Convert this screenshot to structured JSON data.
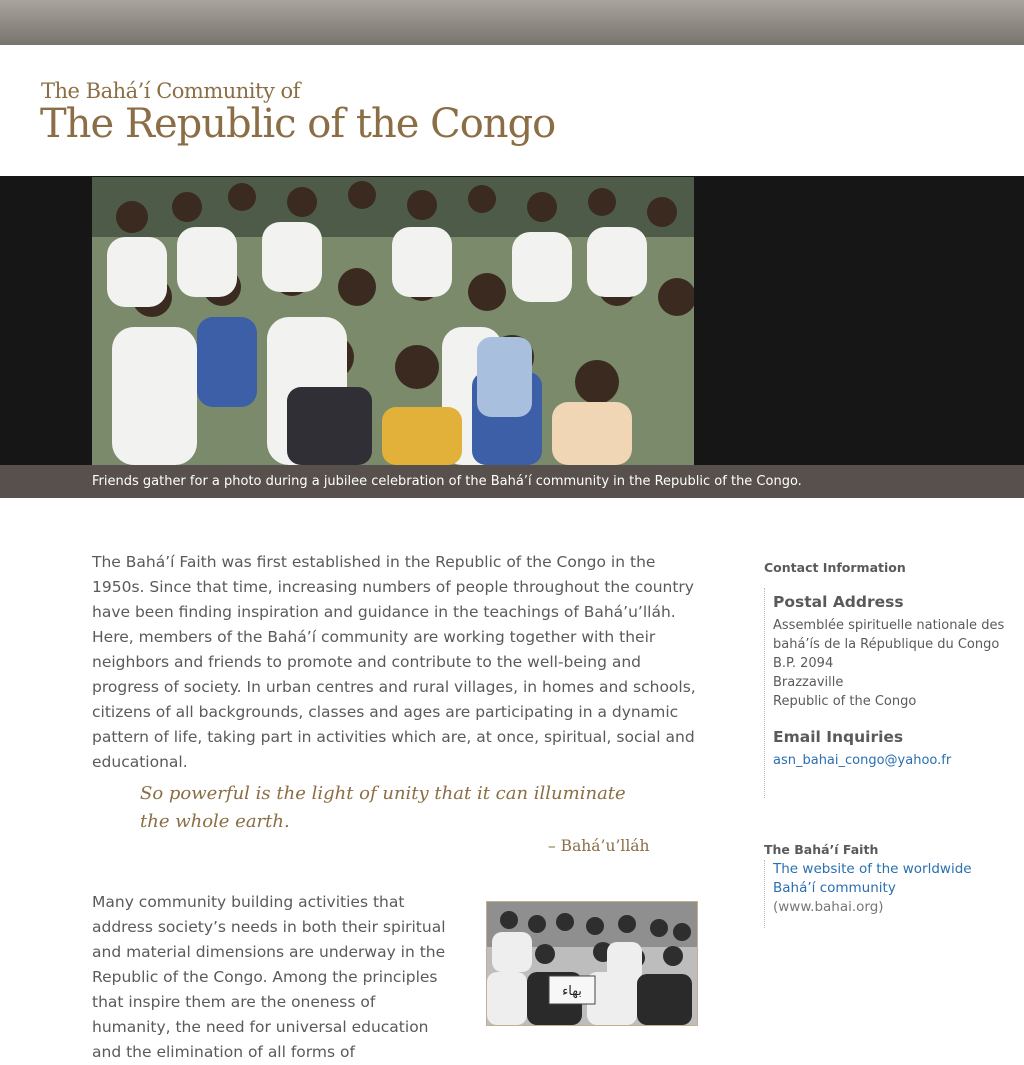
{
  "header": {
    "title_small": "The Bahá’í Community of",
    "title_big": "The Republic of the Congo"
  },
  "hero": {
    "caption": "Friends gather for a photo during a jubilee celebration of the Bahá’í community in the Republic of the Congo."
  },
  "main": {
    "intro": "The Bahá’í Faith was first established in the Republic of the Congo in the 1950s. Since that time, increasing numbers of people throughout the country have been finding inspiration and guidance in the teachings of Bahá’u’lláh. Here, members of the Bahá’í community are working together with their neighbors and friends to promote and contribute to the well-being and progress of society. In urban centres and rural villages, in homes and schools, citizens of all backgrounds, classes and ages are participating in a dynamic pattern of life, taking part in activities which are, at once, spiritual, social and educational.",
    "quote": "So powerful is the light of unity that it can illuminate the whole earth.",
    "quote_attribution": "– Bahá’u’lláh",
    "para2": "Many community building activities that address society’s needs in both their spiritual and material dimensions are underway in the Republic of the Congo. Among the principles that inspire them are the oneness of humanity, the need for universal education and the elimination of all forms of"
  },
  "sidebar": {
    "contact_heading": "Contact Information",
    "postal_title": "Postal Address",
    "postal_lines": [
      "Assemblée spirituelle nationale des",
      "bahá’ís de la République du Congo",
      "B.P. 2094",
      "Brazzaville",
      "Republic of the Congo"
    ],
    "email_title": "Email Inquiries",
    "email": "asn_bahai_congo@yahoo.fr",
    "faith_heading": "The Bahá’í Faith",
    "faith_link": "The website of the worldwide Bahá’í community",
    "faith_url": "(www.bahai.org)"
  },
  "colors": {
    "accent": "#8b6e45",
    "link": "#2a6fb0",
    "caption_bar": "#58504c"
  }
}
